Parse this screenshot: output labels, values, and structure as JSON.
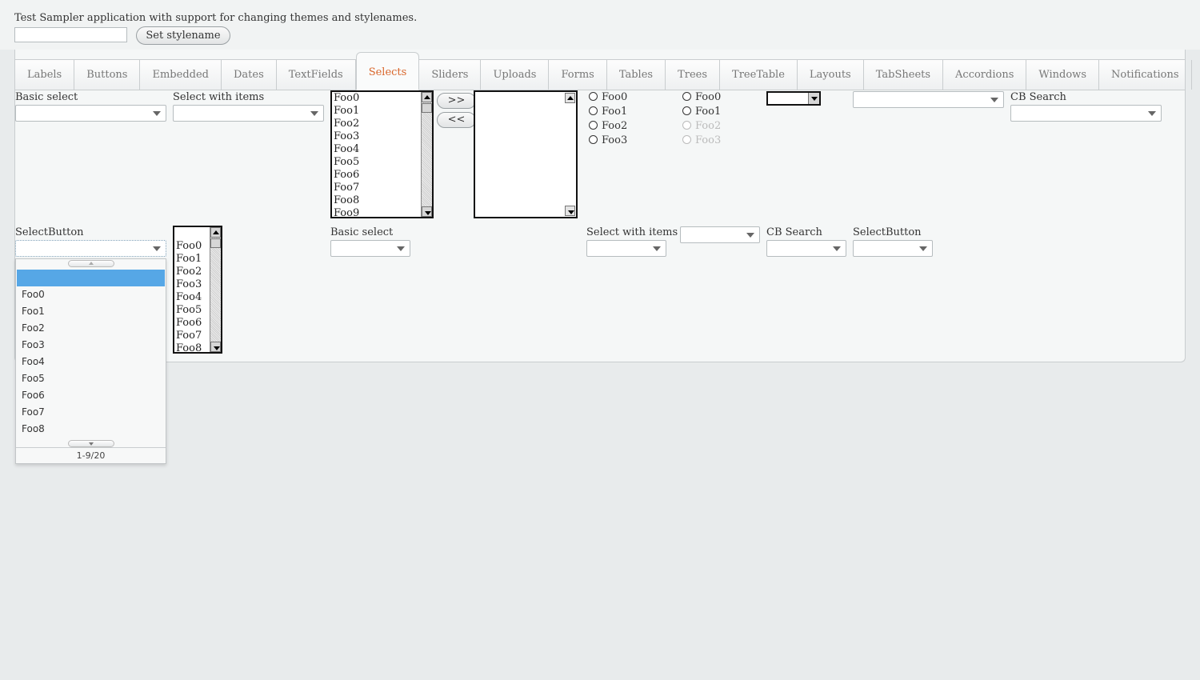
{
  "intro": "Test Sampler application with support for changing themes and stylenames.",
  "stylename": {
    "value": "",
    "button": "Set stylename"
  },
  "tabs": [
    "Labels",
    "Buttons",
    "Embedded",
    "Dates",
    "TextFields",
    "Selects",
    "Sliders",
    "Uploads",
    "Forms",
    "Tables",
    "Trees",
    "TreeTable",
    "Layouts",
    "TabSheets",
    "Accordions",
    "Windows",
    "Notifications"
  ],
  "selected_tab": "Selects",
  "row1": {
    "basic_select": "Basic select",
    "select_with_items": "Select with items",
    "listbox_items": [
      "Foo0",
      "Foo1",
      "Foo2",
      "Foo3",
      "Foo4",
      "Foo5",
      "Foo6",
      "Foo7",
      "Foo8",
      "Foo9"
    ],
    "twincol_add": ">>",
    "twincol_remove": "<<",
    "radio_a": [
      "Foo0",
      "Foo1",
      "Foo2",
      "Foo3"
    ],
    "radio_b": [
      "Foo0",
      "Foo1",
      "Foo2",
      "Foo3"
    ],
    "cb_search": "CB Search"
  },
  "row2": {
    "select_button": "SelectButton",
    "listbox_items": [
      "Foo0",
      "Foo1",
      "Foo2",
      "Foo3",
      "Foo4",
      "Foo5",
      "Foo6",
      "Foo7",
      "Foo8"
    ],
    "basic_select": "Basic select",
    "select_with_items": "Select with items",
    "cb_search": "CB Search",
    "select_button_2": "SelectButton"
  },
  "popup": {
    "items": [
      "",
      "Foo0",
      "Foo1",
      "Foo2",
      "Foo3",
      "Foo4",
      "Foo5",
      "Foo6",
      "Foo7",
      "Foo8"
    ],
    "status": "1-9/20"
  },
  "colors": {
    "accent": "#d9662b",
    "selection": "#56a7e6",
    "background": "#e8ebec"
  }
}
